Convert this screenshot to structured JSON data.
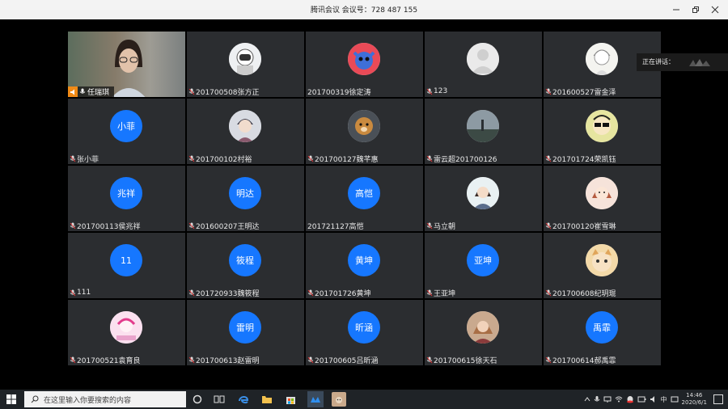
{
  "window": {
    "title": "腾讯会议 会议号：728 487 155"
  },
  "speaking": {
    "label": "正在讲话："
  },
  "participants": [
    {
      "name": "任瑞琪",
      "type": "video"
    },
    {
      "name": "201700508张方正",
      "type": "image",
      "avatar": "astronaut-avatar"
    },
    {
      "name": "201700319徐定涛",
      "type": "image",
      "avatar": "cartoon-avatar"
    },
    {
      "name": "123",
      "type": "image",
      "avatar": "default-avatar"
    },
    {
      "name": "201600527雷金泽",
      "type": "image",
      "avatar": "anime-sketch-avatar"
    },
    {
      "name": "张小菲",
      "type": "initials",
      "initials": "小菲"
    },
    {
      "name": "201700102村裕",
      "type": "image",
      "avatar": "anime-boy-avatar"
    },
    {
      "name": "201700127魏芊惠",
      "type": "image",
      "avatar": "dog-avatar"
    },
    {
      "name": "雷云超201700126",
      "type": "image",
      "avatar": "landscape-avatar"
    },
    {
      "name": "201701724荣凯钰",
      "type": "image",
      "avatar": "sunglasses-avatar"
    },
    {
      "name": "201700113侯兆祥",
      "type": "initials",
      "initials": "兆祥"
    },
    {
      "name": "201600207王明达",
      "type": "initials",
      "initials": "明达"
    },
    {
      "name": "201721127高恺",
      "type": "initials",
      "initials": "高恺"
    },
    {
      "name": "马立朝",
      "type": "image",
      "avatar": "girl-avatar"
    },
    {
      "name": "201700120崔雪琳",
      "type": "image",
      "avatar": "cartoon-girl-avatar"
    },
    {
      "name": "111",
      "type": "initials",
      "initials": "11"
    },
    {
      "name": "201720933魏筱程",
      "type": "initials",
      "initials": "筱程"
    },
    {
      "name": "201701726黄坤",
      "type": "initials",
      "initials": "黄坤"
    },
    {
      "name": "王亚坤",
      "type": "initials",
      "initials": "亚坤"
    },
    {
      "name": "201700608纪玥琨",
      "type": "image",
      "avatar": "cat-avatar"
    },
    {
      "name": "201700521袁育良",
      "type": "image",
      "avatar": "pink-cartoon-avatar"
    },
    {
      "name": "201700613赵雷明",
      "type": "initials",
      "initials": "雷明"
    },
    {
      "name": "201700605吕昕涵",
      "type": "initials",
      "initials": "昕涵"
    },
    {
      "name": "201700615徐天石",
      "type": "image",
      "avatar": "portrait-avatar"
    },
    {
      "name": "201700614郝禹霏",
      "type": "initials",
      "initials": "禹霏"
    }
  ],
  "taskbar": {
    "search_placeholder": "在这里输入你要搜索的内容",
    "ime": "中",
    "time": "14:46",
    "date": "2020/6/1"
  },
  "colors": {
    "initials_bg": "#1677ff",
    "tile_bg": "#2b2d30",
    "speaking_badge": "#f08a16"
  }
}
